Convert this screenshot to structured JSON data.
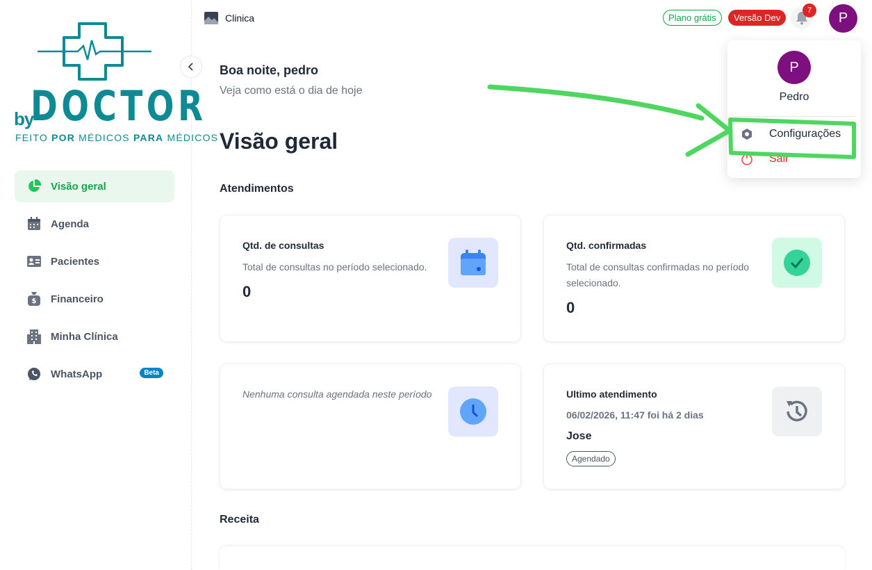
{
  "brand": {
    "by": "by",
    "name": "DOCTOR",
    "tagline_pre": "FEITO ",
    "tagline_b1": "POR",
    "tagline_mid": " MÉDICOS ",
    "tagline_b2": "PARA",
    "tagline_post": " MÉDICOS",
    "color": "#0e8a94"
  },
  "sidebar": {
    "items": [
      {
        "label": "Visão geral",
        "icon": "pie-chart-icon",
        "active": true
      },
      {
        "label": "Agenda",
        "icon": "calendar-icon"
      },
      {
        "label": "Pacientes",
        "icon": "id-card-icon"
      },
      {
        "label": "Financeiro",
        "icon": "money-bag-icon"
      },
      {
        "label": "Minha Clínica",
        "icon": "building-icon"
      },
      {
        "label": "WhatsApp",
        "icon": "whatsapp-icon",
        "badge": "Beta"
      }
    ]
  },
  "topbar": {
    "clinic_name": "Clinica",
    "plan_badge": "Plano grátis",
    "version_badge": "Versão Dev",
    "notification_count": "7",
    "avatar_initial": "P"
  },
  "main": {
    "greeting": "Boa noite, pedro",
    "greeting_sub": "Veja como está o dia de hoje",
    "title": "Visão geral",
    "section_attendance": "Atendimentos",
    "section_revenue": "Receita",
    "cards": {
      "consultas": {
        "title": "Qtd. de consultas",
        "desc": "Total de consultas no período selecionado.",
        "value": "0"
      },
      "confirmadas": {
        "title": "Qtd. confirmadas",
        "desc": "Total de consultas confirmadas no período selecionado.",
        "value": "0"
      },
      "agendadas": {
        "empty": "Nenhuma consulta agendada neste período"
      },
      "ultimo": {
        "title": "Ultimo atendimento",
        "date": "06/02/2026, 11:47 foi há 2 dias",
        "patient": "Jose",
        "status": "Agendado"
      }
    }
  },
  "dropdown": {
    "avatar_initial": "P",
    "user_name": "Pedro",
    "settings_label": "Configurações",
    "logout_label": "Sair"
  },
  "colors": {
    "accent_green": "#16a34a",
    "danger": "#dc2626",
    "avatar_purple": "#7e0f7e",
    "annotation_green": "#4fd660"
  }
}
